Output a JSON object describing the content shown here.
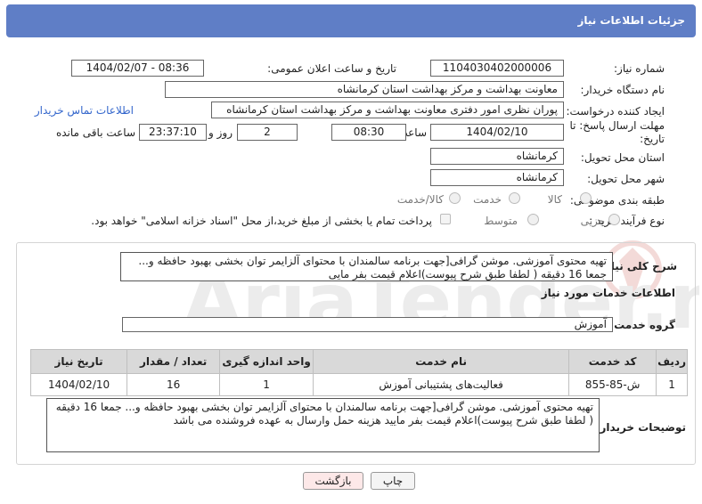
{
  "header": {
    "title": "جزئیات اطلاعات نیاز"
  },
  "fields": {
    "need_number_label": "شماره نیاز:",
    "need_number": "1104030402000006",
    "announce_label": "تاریخ و ساعت اعلان عمومی:",
    "announce_value": "1404/02/07 - 08:36",
    "buyer_org_label": "نام دستگاه خریدار:",
    "buyer_org": "معاونت بهداشت و مرکز بهداشت استان کرمانشاه",
    "requester_label": "ایجاد کننده درخواست:",
    "requester": "پوران نظری امور دفتری معاونت بهداشت و مرکز بهداشت استان کرمانشاه",
    "contact_link": "اطلاعات تماس خریدار",
    "deadline_label": "مهلت ارسال پاسخ: تا تاریخ:",
    "deadline_date": "1404/02/10",
    "time_label": "ساعت",
    "deadline_time": "08:30",
    "days_value": "2",
    "days_label": "روز و",
    "remaining_time": "23:37:10",
    "remaining_label": "ساعت باقی مانده",
    "province_label": "استان محل تحویل:",
    "province": "کرمانشاه",
    "city_label": "شهر محل تحویل:",
    "city": "کرمانشاه",
    "category_label": "طبقه بندی موضوعی:",
    "category_options": [
      "کالا",
      "خدمت",
      "کالا/خدمت"
    ],
    "process_label": "نوع فرآیند خرید :",
    "process_options": [
      "جزیی",
      "متوسط"
    ],
    "payment_note": "پرداخت تمام یا بخشی از مبلغ خرید،از محل \"اسناد خزانه اسلامی\" خواهد بود."
  },
  "summary": {
    "label": "شرح کلی نیاز:",
    "text": "تهیه محتوی آموزشی. موشن گرافی[جهت برنامه سالمندان با محتوای آلزایمر توان بخشی بهبود حافظه و... جمعا 16 دقیقه ( لطفا طبق شرح پیوست)اعلام قیمت بفر مایی"
  },
  "services": {
    "heading": "اطلاعات خدمات مورد نیاز",
    "group_label": "گروه خدمت:",
    "group_value": "آموزش",
    "columns": [
      "ردیف",
      "کد خدمت",
      "نام خدمت",
      "واحد اندازه گیری",
      "تعداد / مقدار",
      "تاریخ نیاز"
    ],
    "rows": [
      {
        "index": "1",
        "code": "ش-85-855",
        "name": "فعالیت‌های پشتیبانی آموزش",
        "unit": "1",
        "qty": "16",
        "date": "1404/02/10"
      }
    ]
  },
  "buyer_notes": {
    "label": "توضیحات خریدار:",
    "text": "تهیه محتوی آموزشی. موشن گرافی[جهت برنامه سالمندان با محتوای آلزایمر توان بخشی بهبود حافظه و... جمعا 16 دقیقه ( لطفا طبق شرح پیوست)اعلام قیمت بفر مایید هزینه حمل وارسال به عهده فروشنده می باشد"
  },
  "buttons": {
    "print": "چاپ",
    "back": "بازگشت"
  },
  "colors": {
    "title_bar": "#5f7ec6",
    "link": "#3366cc",
    "back_button": "#fde8e8"
  },
  "watermark": "AriaTender.neT"
}
